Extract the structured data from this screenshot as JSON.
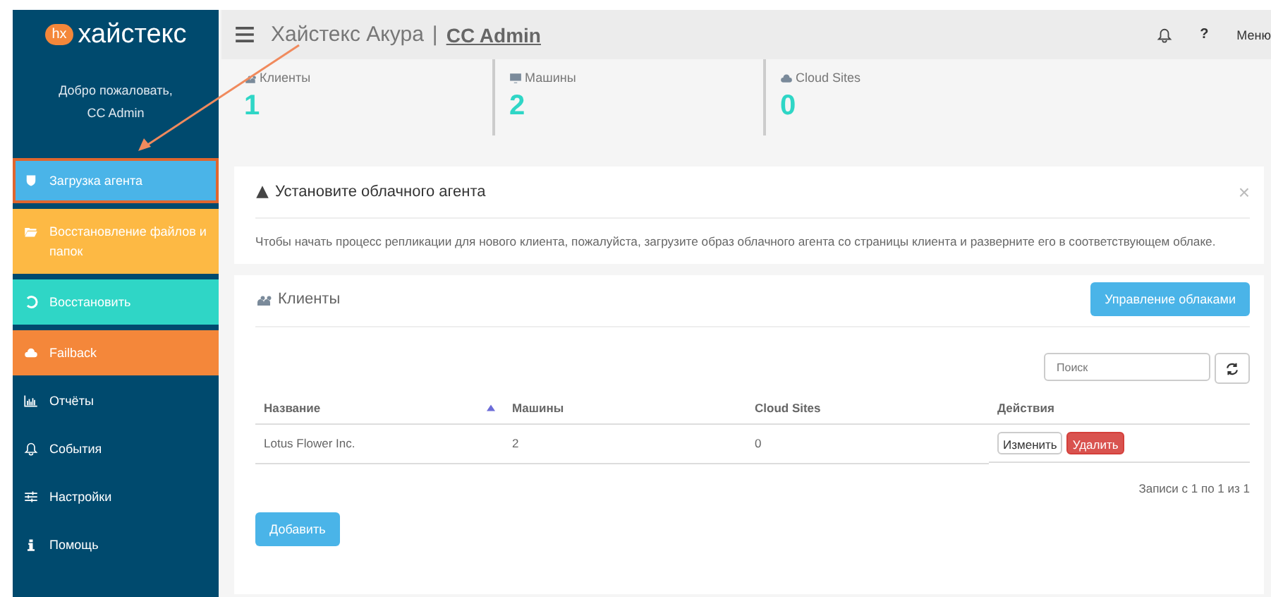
{
  "logo": {
    "badge": "hx",
    "name": "хайстекс"
  },
  "welcome": {
    "greeting": "Добро пожаловать,",
    "user": "CC Admin"
  },
  "sidebar": {
    "items": [
      {
        "label": "Загрузка агента",
        "color": "#4ab4e8",
        "selected": true
      },
      {
        "label": "Восстановление файлов и папок",
        "color": "#fdb944",
        "selected": false
      },
      {
        "label": "Восстановить",
        "color": "#2fd6c6",
        "selected": false
      },
      {
        "label": "Failback",
        "color": "#f4873a",
        "selected": false
      },
      {
        "label": "Отчёты",
        "color": "#004a6e",
        "selected": false
      },
      {
        "label": "События",
        "color": "#004a6e",
        "selected": false
      },
      {
        "label": "Настройки",
        "color": "#004a6e",
        "selected": false
      },
      {
        "label": "Помощь",
        "color": "#004a6e",
        "selected": false
      }
    ]
  },
  "topbar": {
    "title": "Хайстекс Акура",
    "separator": "|",
    "tenant": "CC Admin",
    "help": "?",
    "menu": "Меню"
  },
  "stats": [
    {
      "label": "Клиенты",
      "value": "1"
    },
    {
      "label": "Машины",
      "value": "2"
    },
    {
      "label": "Cloud Sites",
      "value": "0"
    }
  ],
  "notice": {
    "title": "Установите облачного агента",
    "close": "×",
    "text": "Чтобы начать процесс репликации для нового клиента, пожалуйста, загрузите образ облачного агента со страницы клиента и разверните его в соответствующем облаке."
  },
  "clients": {
    "title": "Клиенты",
    "manage_button": "Управление облаками",
    "search": {
      "placeholder": "Поиск"
    },
    "columns": [
      "Название",
      "Машины",
      "Cloud Sites",
      "Действия"
    ],
    "rows": [
      {
        "name": "Lotus Flower Inc.",
        "machines": "2",
        "cloud_sites": "0",
        "actions": [
          "Изменить",
          "Удалить"
        ]
      }
    ],
    "info": "Записи с 1 по 1 из 1",
    "add_button": "Добавить"
  }
}
